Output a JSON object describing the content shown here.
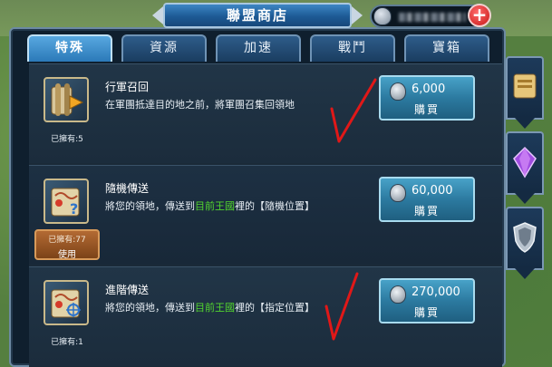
{
  "header": {
    "title": "聯盟商店",
    "plus_label": "+"
  },
  "tabs": [
    {
      "label": "特殊",
      "active": true
    },
    {
      "label": "資源",
      "active": false
    },
    {
      "label": "加速",
      "active": false
    },
    {
      "label": "戰鬥",
      "active": false
    },
    {
      "label": "寶箱",
      "active": false
    }
  ],
  "items": [
    {
      "name": "行軍召回",
      "desc": "在軍團抵達目的地之前，將軍團召集回領地",
      "owned": "已擁有:5",
      "price": "6,000",
      "buy_label": "購買",
      "icon": "recall-scroll-icon"
    },
    {
      "name": "隨機傳送",
      "desc_prefix": "將您的領地，傳送到",
      "desc_highlight": "目前王國",
      "desc_suffix": "裡的【隨機位置】",
      "owned": "已擁有:77",
      "use_label": "使用",
      "price": "60,000",
      "buy_label": "購買",
      "icon": "random-teleport-map-icon"
    },
    {
      "name": "進階傳送",
      "desc_prefix": "將您的領地，傳送到",
      "desc_highlight": "目前王國",
      "desc_suffix": "裡的【指定位置】",
      "owned": "已擁有:1",
      "price": "270,000",
      "buy_label": "購買",
      "icon": "advanced-teleport-map-icon"
    }
  ],
  "colors": {
    "highlight": "#53d62e",
    "accent": "#2c7aa0",
    "mark": "#e01818"
  },
  "side_icons": [
    "scroll-icon",
    "purple-gem-icon",
    "shield-icon"
  ]
}
